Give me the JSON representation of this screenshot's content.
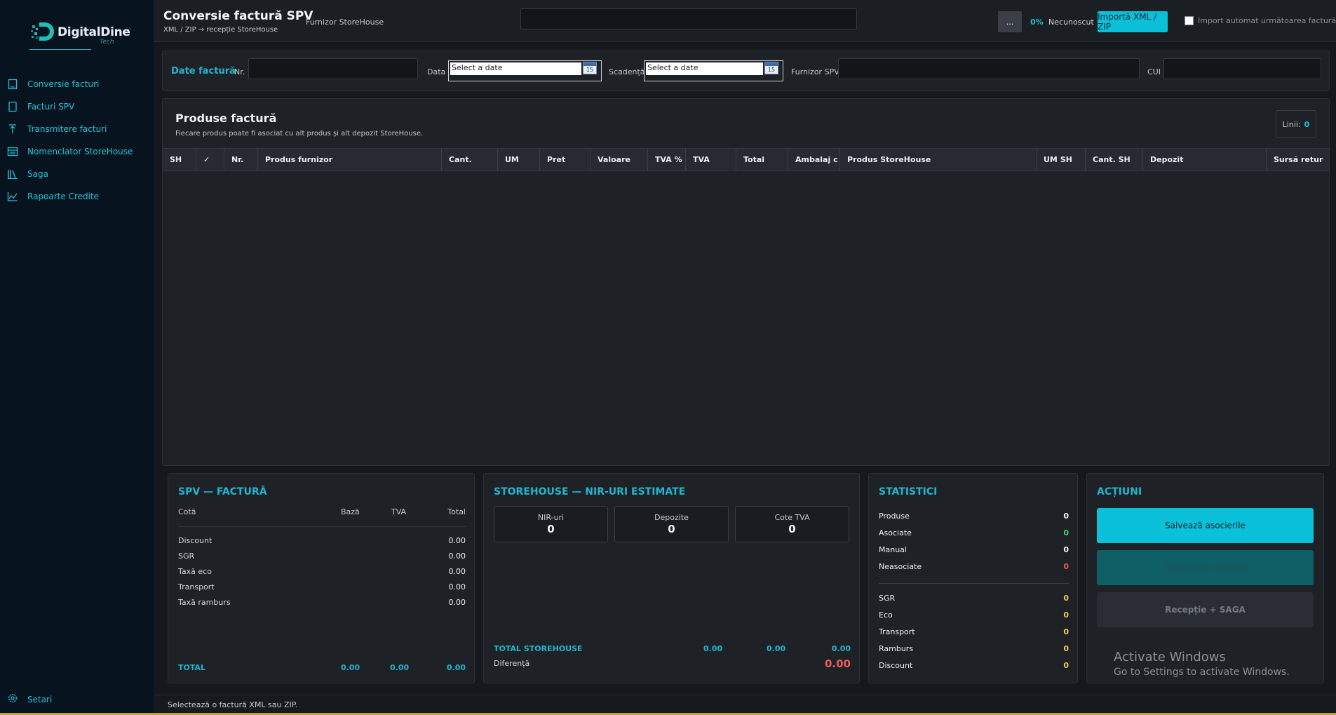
{
  "sidebar": {
    "brand": "DigitalDine",
    "brand_sub": "Tech",
    "items": [
      {
        "label": "Conversie facturi",
        "icon": "document-icon"
      },
      {
        "label": "Facturi SPV",
        "icon": "file-icon"
      },
      {
        "label": "Transmitere facturi",
        "icon": "upload-icon"
      },
      {
        "label": "Nomenclator StoreHouse",
        "icon": "warehouse-icon"
      },
      {
        "label": "Saga",
        "icon": "books-icon"
      },
      {
        "label": "Rapoarte Credite",
        "icon": "chart-icon"
      }
    ],
    "settings": "Setari"
  },
  "header": {
    "title": "Conversie factură SPV",
    "subtitle": "XML / ZIP → recepție StoreHouse",
    "supplier_label": "Furnizor StoreHouse",
    "supplier_value": "",
    "dots": "...",
    "percent": "0%",
    "status": "Necunoscut",
    "import_button": "Importă XML / ZIP",
    "auto_import_label": "Import automat următoarea factură"
  },
  "invoice": {
    "section": "Date factură",
    "nr_label": "Nr.",
    "date_label": "Data",
    "date_placeholder": "Select a date",
    "due_label": "Scadență",
    "due_placeholder": "Select a date",
    "calendar_day": "15",
    "spv_supplier_label": "Furnizor SPV",
    "cui_label": "CUI"
  },
  "products": {
    "title": "Produse factură",
    "subtitle": "Fiecare produs poate fi asociat cu alt produs și alt depozit StoreHouse.",
    "lines_label": "Linii:",
    "lines_value": "0",
    "columns": [
      "SH",
      "✓",
      "Nr.",
      "Produs furnizor",
      "Cant.",
      "UM",
      "Pret",
      "Valoare",
      "TVA %",
      "TVA",
      "Total",
      "Ambalaj c",
      "Produs StoreHouse",
      "UM SH",
      "Cant. SH",
      "Depozit",
      "Sursă retur"
    ]
  },
  "spv": {
    "title": "SPV — FACTURĂ",
    "headers": [
      "Cotă",
      "Bază",
      "TVA",
      "Total"
    ],
    "rows": [
      {
        "label": "Discount",
        "value": "0.00"
      },
      {
        "label": "SGR",
        "value": "0.00"
      },
      {
        "label": "Taxă eco",
        "value": "0.00"
      },
      {
        "label": "Transport",
        "value": "0.00"
      },
      {
        "label": "Taxă ramburs",
        "value": "0.00"
      }
    ],
    "total_label": "TOTAL",
    "total_values": [
      "0.00",
      "0.00",
      "0.00"
    ]
  },
  "storehouse": {
    "title": "STOREHOUSE — NIR-URI ESTIMATE",
    "boxes": [
      {
        "label": "NIR-uri",
        "value": "0"
      },
      {
        "label": "Depozite",
        "value": "0"
      },
      {
        "label": "Cote TVA",
        "value": "0"
      }
    ],
    "total_label": "TOTAL STOREHOUSE",
    "total_values": [
      "0.00",
      "0.00",
      "0.00"
    ],
    "diff_label": "Diferență",
    "diff_value": "0.00"
  },
  "stats": {
    "title": "STATISTICI",
    "top": [
      {
        "label": "Produse",
        "value": "0",
        "color": "#f2f4f6"
      },
      {
        "label": "Asociate",
        "value": "0",
        "color": "#3fd06a"
      },
      {
        "label": "Manual",
        "value": "0",
        "color": "#f2f4f6"
      },
      {
        "label": "Neasociate",
        "value": "0",
        "color": "#ee5a5a"
      }
    ],
    "bottom": [
      {
        "label": "SGR",
        "value": "0",
        "color": "#f2c94c"
      },
      {
        "label": "Eco",
        "value": "0",
        "color": "#f2c94c"
      },
      {
        "label": "Transport",
        "value": "0",
        "color": "#f2c94c"
      },
      {
        "label": "Ramburs",
        "value": "0",
        "color": "#f2c94c"
      },
      {
        "label": "Discount",
        "value": "0",
        "color": "#f2c94c"
      }
    ]
  },
  "actions": {
    "title": "ACȚIUNI",
    "save": "Salvează asocierile",
    "generate": "Generează recepția",
    "saga": "Recepție + SAGA"
  },
  "watermark": {
    "line1": "Activate Windows",
    "line2": "Go to Settings to activate Windows."
  },
  "status_bar": "Selectează o factură XML sau ZIP."
}
